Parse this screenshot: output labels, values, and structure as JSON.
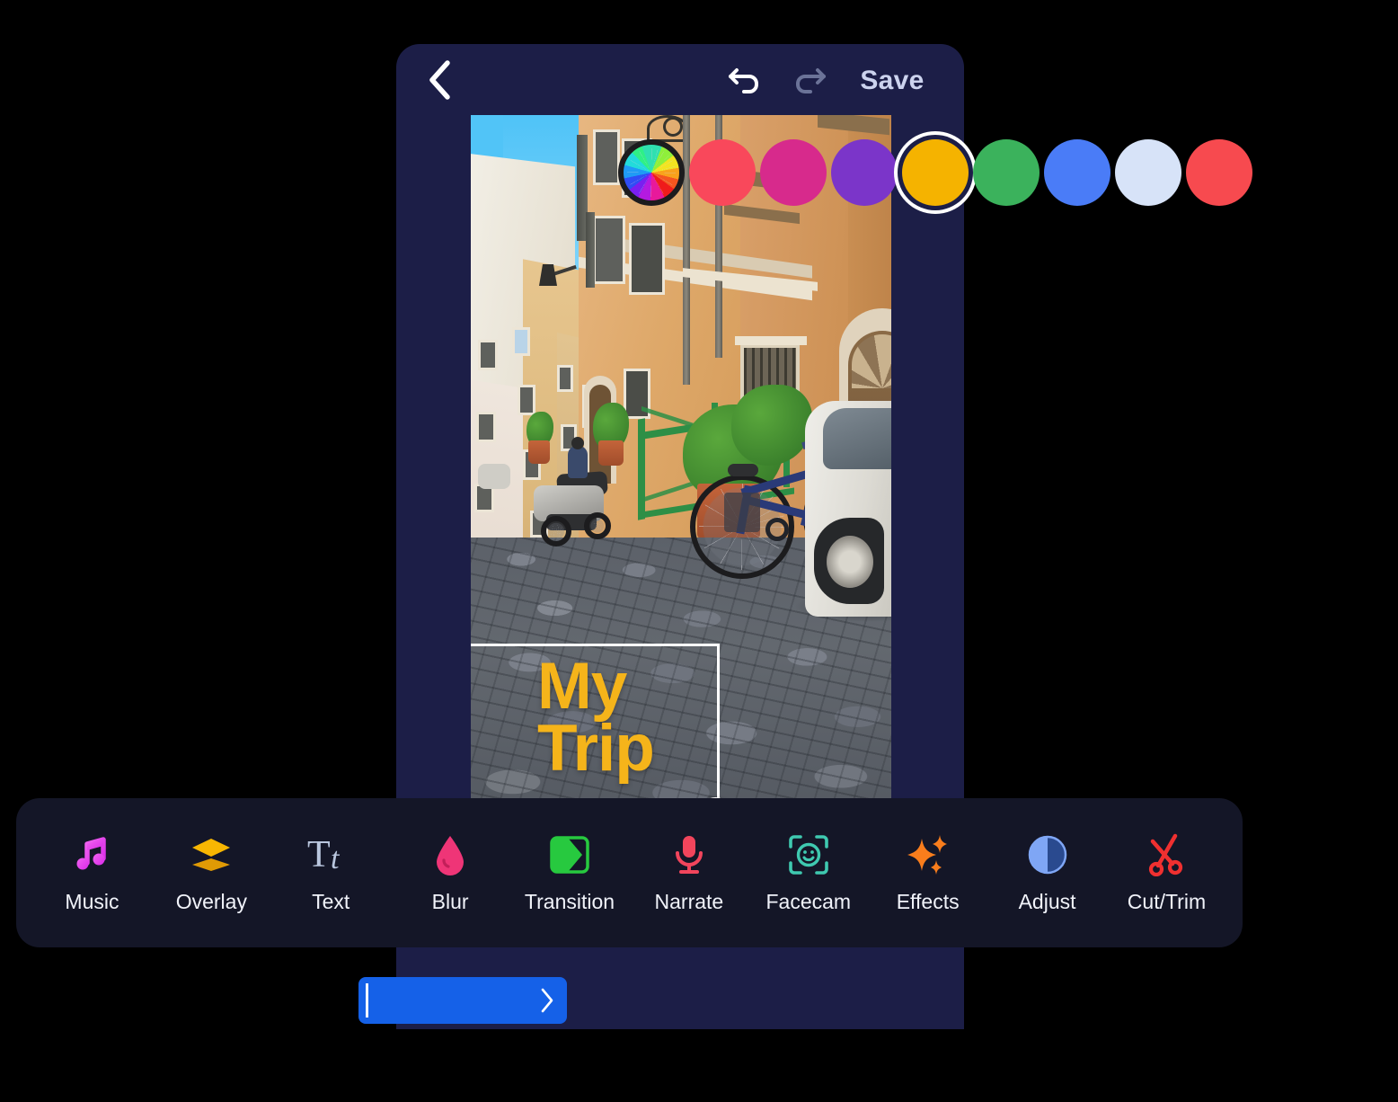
{
  "app": {
    "topbar": {
      "back_icon": "chevron-left-icon",
      "undo_icon": "undo-icon",
      "redo_icon": "redo-icon",
      "save_label": "Save"
    },
    "canvas": {
      "overlay_text_line1": "My",
      "overlay_text_line2": "Trip",
      "overlay_text_color": "#f5b41a",
      "rotate_handle_icon": "rotate-icon",
      "selection_border_color": "#ffffff",
      "photo_description": "Cobblestone street in Rome with ochre buildings, bicycle, scooter and parked white car"
    },
    "color_palette": {
      "selected_index": 4,
      "swatches": [
        {
          "name": "color-wheel",
          "hex": "rainbow"
        },
        {
          "name": "coral-red",
          "hex": "#f9485b"
        },
        {
          "name": "magenta",
          "hex": "#d72a8c"
        },
        {
          "name": "purple",
          "hex": "#7b35c9"
        },
        {
          "name": "amber",
          "hex": "#f5b300"
        },
        {
          "name": "green",
          "hex": "#3bb25c"
        },
        {
          "name": "blue",
          "hex": "#4a7cf7"
        },
        {
          "name": "pale-blue",
          "hex": "#d7e3f8"
        },
        {
          "name": "red",
          "hex": "#f74a4f"
        }
      ]
    },
    "toolbar": {
      "items": [
        {
          "label": "Music",
          "icon": "music-note-icon",
          "color": "#e03cf0"
        },
        {
          "label": "Overlay",
          "icon": "layers-icon",
          "color": "#f5b300"
        },
        {
          "label": "Text",
          "icon": "text-tt-icon",
          "color": "#b9c6de"
        },
        {
          "label": "Blur",
          "icon": "water-drop-icon",
          "color": "#ef3577"
        },
        {
          "label": "Transition",
          "icon": "transition-icon",
          "color": "#27c93f"
        },
        {
          "label": "Narrate",
          "icon": "microphone-icon",
          "color": "#f2455c"
        },
        {
          "label": "Facecam",
          "icon": "face-scan-icon",
          "color": "#3fc9b0"
        },
        {
          "label": "Effects",
          "icon": "sparkles-icon",
          "color": "#f97d1c"
        },
        {
          "label": "Adjust",
          "icon": "contrast-icon",
          "color": "#7fa6f5"
        },
        {
          "label": "Cut/Trim",
          "icon": "scissors-icon",
          "color": "#f03030"
        }
      ]
    },
    "timeline": {
      "clip_color": "#1561e8",
      "playhead_icon": "playhead-marker",
      "chevron_icon": "chevron-right-icon"
    }
  }
}
